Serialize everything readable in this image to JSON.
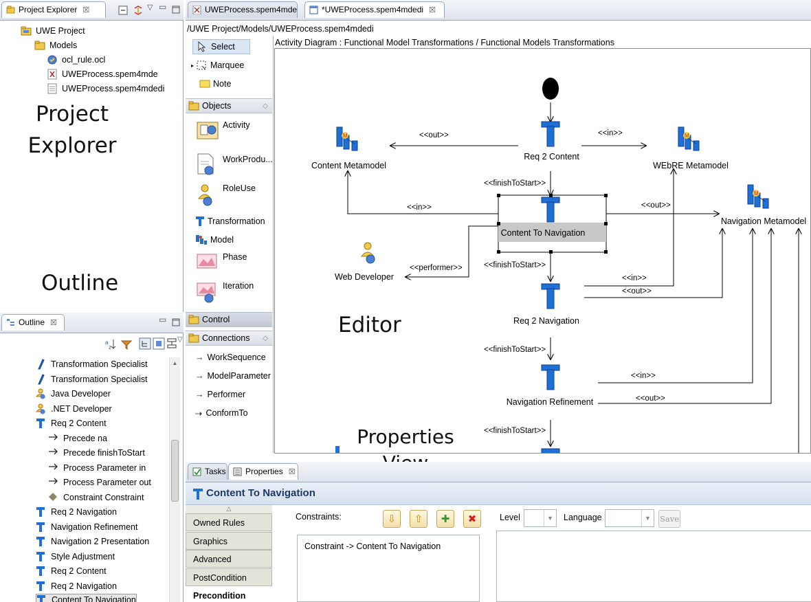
{
  "explorer": {
    "tab_label": "Project Explorer",
    "tab_close": "☒",
    "items": [
      {
        "label": "UWE Project"
      },
      {
        "label": "Models"
      },
      {
        "label": "ocl_rule.ocl"
      },
      {
        "label": "UWEProcess.spem4mde"
      },
      {
        "label": "UWEProcess.spem4mdedi"
      }
    ]
  },
  "annotations": {
    "project_explorer": "Project\nExplorer",
    "outline": "Outline",
    "editor": "Editor",
    "properties_view": "Properties\nView"
  },
  "outline": {
    "tab_label": "Outline",
    "tab_close": "☒",
    "items": [
      {
        "label": "Transformation Specialist",
        "icon": "role-icon"
      },
      {
        "label": "Transformation Specialist",
        "icon": "role-icon"
      },
      {
        "label": "Java Developer",
        "icon": "role-use-icon"
      },
      {
        "label": ".NET Developer",
        "icon": "role-use-icon"
      },
      {
        "label": "Req 2 Content",
        "icon": "transformation-icon"
      },
      {
        "label": "Precede na",
        "icon": "arrow-icon"
      },
      {
        "label": "Precede finishToStart",
        "icon": "arrow-icon"
      },
      {
        "label": "Process Parameter in",
        "icon": "arrow-icon"
      },
      {
        "label": "Process Parameter out",
        "icon": "arrow-icon"
      },
      {
        "label": "Constraint Constraint",
        "icon": "constraint-icon"
      },
      {
        "label": "Req 2 Navigation",
        "icon": "transformation-icon"
      },
      {
        "label": "Navigation Refinement",
        "icon": "transformation-icon"
      },
      {
        "label": "Navigation 2 Presentation",
        "icon": "transformation-icon"
      },
      {
        "label": "Style Adjustment",
        "icon": "transformation-icon"
      },
      {
        "label": "Req 2 Content",
        "icon": "transformation-icon"
      },
      {
        "label": "Req 2 Navigation",
        "icon": "transformation-icon"
      },
      {
        "label": "Content To Navigation",
        "icon": "transformation-icon"
      }
    ]
  },
  "editor": {
    "tabs": [
      {
        "label": "UWEProcess.spem4mde",
        "active": false
      },
      {
        "label": "*UWEProcess.spem4mdedi",
        "active": true,
        "close": "☒"
      }
    ],
    "path": "/UWE Project/Models/UWEProcess.spem4mdedi",
    "diagram_title": "Activity Diagram : Functional Model Transformations / Functional Models Transformations"
  },
  "palette": {
    "select": "Select",
    "marquee": "Marquee",
    "note": "Note",
    "objects_drawer": "Objects",
    "objects": [
      "Activity",
      "WorkProdu...",
      "RoleUse",
      "Transformation",
      "Model",
      "Phase",
      "Iteration"
    ],
    "control_drawer": "Control",
    "connections_drawer": "Connections",
    "connections": [
      "WorkSequence",
      "ModelParameter",
      "Performer",
      "ConformTo"
    ]
  },
  "diagram": {
    "nodes": {
      "req2content": "Req 2 Content",
      "content_metamodel": "Content Metamodel",
      "webre_metamodel": "WEbRE Metamodel",
      "navigation_metamodel": "Navigation Metamodel",
      "content_to_navigation": "Content To Navigation",
      "web_developer": "Web Developer",
      "req2navigation": "Req 2 Navigation",
      "navigation_refinement": "Navigation Refinement"
    },
    "edge_labels": {
      "out1": "<<out>>",
      "in1": "<<in>>",
      "fts1": "<<finishToStart>>",
      "in2": "<<in>>",
      "out2": "<<out>>",
      "performer": "<<performer>>",
      "fts2": "<<finishToStart>>",
      "in3": "<<in>>",
      "out3": "<<out>>",
      "fts3": "<<finishToStart>>",
      "in4": "<<in>>",
      "out4": "<<out>>",
      "fts4": "<<finishToStart>>"
    }
  },
  "properties": {
    "tabs": [
      {
        "label": "Tasks"
      },
      {
        "label": "Properties",
        "close": "☒"
      }
    ],
    "title": "Content To Navigation",
    "side_tabs": [
      "Owned Rules",
      "Graphics",
      "Advanced",
      "PostCondition",
      "Precondition"
    ],
    "constraints_label": "Constraints:",
    "constraints": [
      "Constraint -> Content To Navigation"
    ],
    "level_label": "Level",
    "language_label": "Language",
    "save_label": "Save"
  },
  "colors": {
    "transformation": "#1f6fd6",
    "selection_fill": "#c8c8c8",
    "folder": "#f2c94c",
    "panel_border": "#9aa6b8"
  }
}
